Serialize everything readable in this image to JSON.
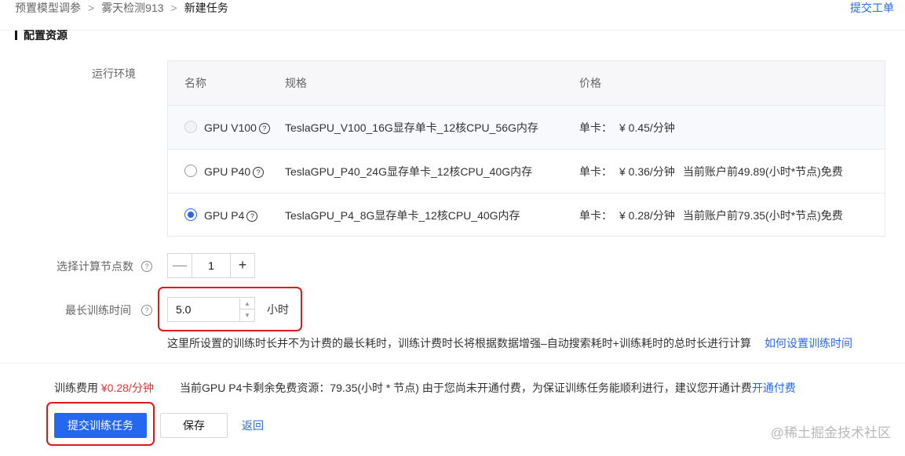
{
  "breadcrumb": {
    "items": [
      "预置模型调参",
      "雾天检测913",
      "新建任务"
    ],
    "separator": ">"
  },
  "header": {
    "submit_ticket": "提交工单"
  },
  "section": {
    "title": "配置资源"
  },
  "runtime": {
    "label": "运行环境",
    "columns": {
      "name": "名称",
      "spec": "规格",
      "price": "价格"
    },
    "rows": [
      {
        "name": "GPU V100",
        "spec": "TeslaGPU_V100_16G显存单卡_12核CPU_56G内存",
        "price_label": "单卡：",
        "price": "¥ 0.45/分钟",
        "note": "",
        "state": "disabled"
      },
      {
        "name": "GPU P40",
        "spec": "TeslaGPU_P40_24G显存单卡_12核CPU_40G内存",
        "price_label": "单卡：",
        "price": "¥ 0.36/分钟",
        "note": "当前账户前49.89(小时*节点)免费",
        "state": "unchecked"
      },
      {
        "name": "GPU P4",
        "spec": "TeslaGPU_P4_8G显存单卡_12核CPU_40G内存",
        "price_label": "单卡：",
        "price": "¥ 0.28/分钟",
        "note": "当前账户前79.35(小时*节点)免费",
        "state": "checked"
      }
    ]
  },
  "nodes": {
    "label": "选择计算节点数",
    "value": "1",
    "minus": "—",
    "plus": "+"
  },
  "train_time": {
    "label": "最长训练时间",
    "value": "5.0",
    "unit": "小时"
  },
  "hint": {
    "text": "这里所设置的训练时长并不为计费的最长耗时，训练计费时长将根据数据增强–自动搜索耗时+训练耗时的总时长进行计算",
    "link": "如何设置训练时间"
  },
  "footer": {
    "fee_label": "训练费用",
    "fee_value": "¥0.28/分钟",
    "notice": "当前GPU P4卡剩余免费资源：79.35(小时 * 节点) 由于您尚未开通付费，为保证训练任务能顺利进行，建议您开通计费",
    "notice_link": "开通付费",
    "submit": "提交训练任务",
    "save": "保存",
    "back": "返回"
  },
  "watermark": "@稀土掘金技术社区",
  "icons": {
    "help": "question-circle-icon"
  },
  "colors": {
    "accent": "#2468f2",
    "price": "#e3342f",
    "highlight": "#e3171a"
  }
}
